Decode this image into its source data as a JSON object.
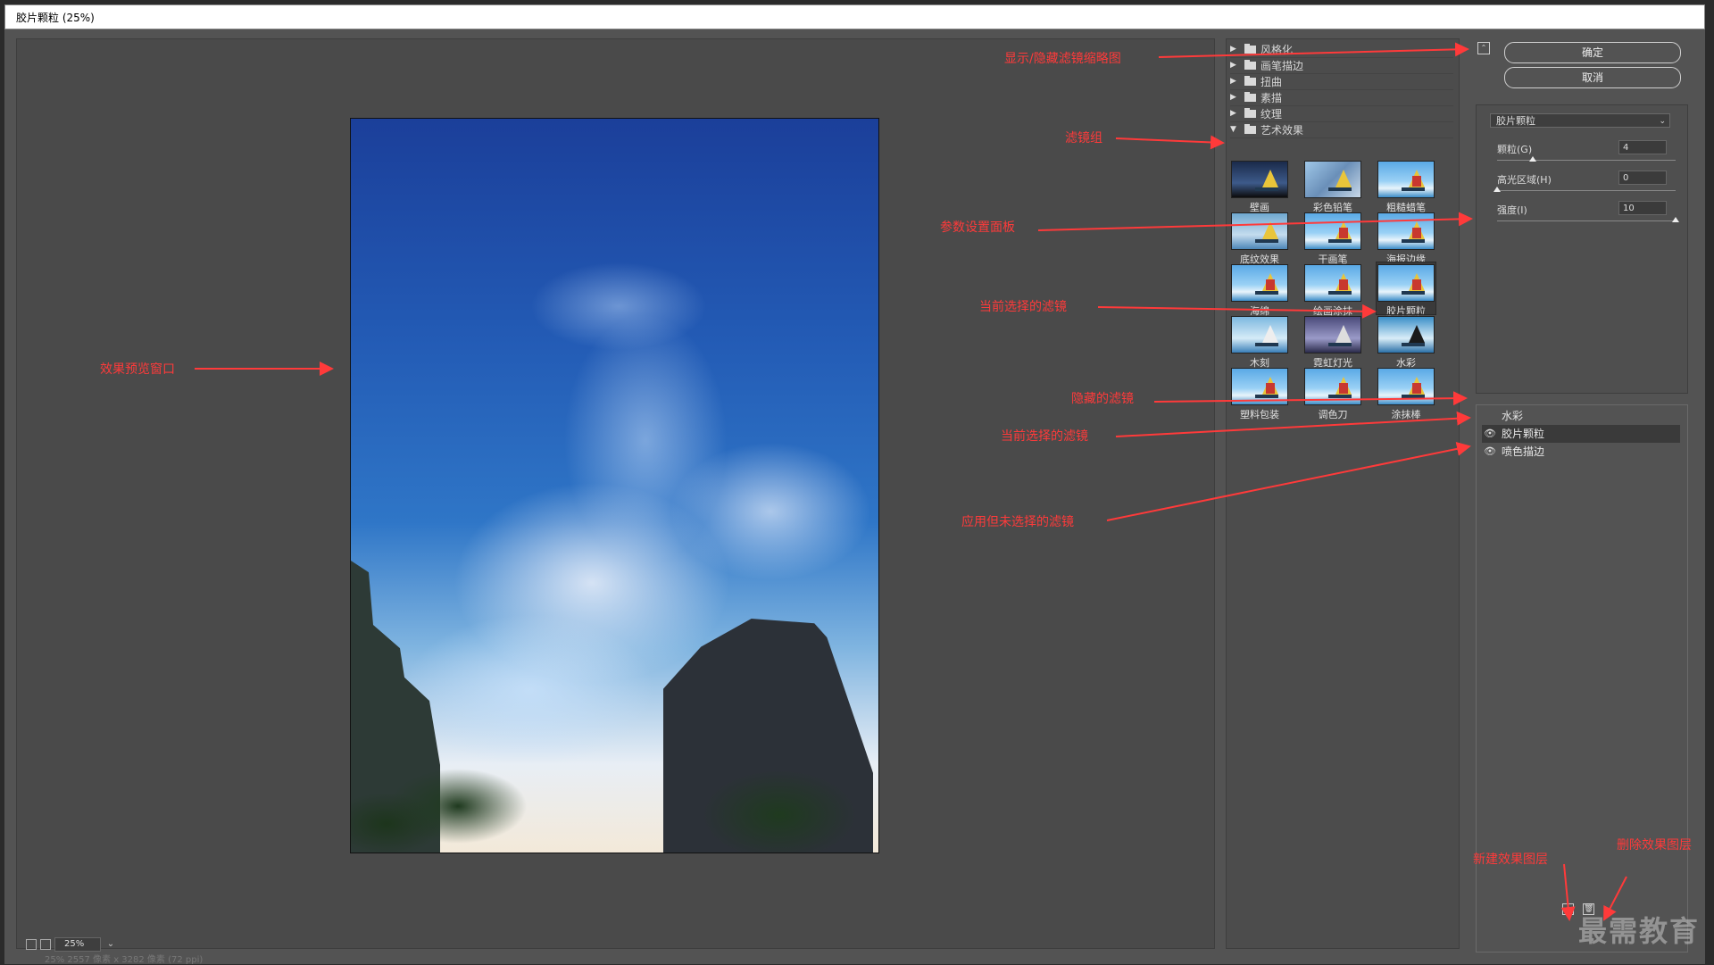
{
  "window": {
    "title": "胶片颗粒 (25%)"
  },
  "preview": {
    "zoom": "25%",
    "status": "25% 2557 像素 x 3282 像素 (72 ppi)"
  },
  "filter_groups": [
    {
      "label": "风格化",
      "expanded": false
    },
    {
      "label": "画笔描边",
      "expanded": false
    },
    {
      "label": "扭曲",
      "expanded": false
    },
    {
      "label": "素描",
      "expanded": false
    },
    {
      "label": "纹理",
      "expanded": false
    },
    {
      "label": "艺术效果",
      "expanded": true
    }
  ],
  "filters": [
    {
      "label": "壁画"
    },
    {
      "label": "彩色铅笔"
    },
    {
      "label": "粗糙蜡笔"
    },
    {
      "label": "底纹效果"
    },
    {
      "label": "干画笔"
    },
    {
      "label": "海报边缘"
    },
    {
      "label": "海绵"
    },
    {
      "label": "绘画涂抹"
    },
    {
      "label": "胶片颗粒",
      "selected": true
    },
    {
      "label": "木刻"
    },
    {
      "label": "霓虹灯光"
    },
    {
      "label": "水彩"
    },
    {
      "label": "塑料包装"
    },
    {
      "label": "调色刀"
    },
    {
      "label": "涂抹棒"
    }
  ],
  "buttons": {
    "ok": "确定",
    "cancel": "取消"
  },
  "params": {
    "filter": "胶片颗粒",
    "items": [
      {
        "name": "颗粒(G)",
        "value": "4",
        "fraction": 0.2
      },
      {
        "name": "高光区域(H)",
        "value": "0",
        "fraction": 0.0
      },
      {
        "name": "强度(I)",
        "value": "10",
        "fraction": 1.0
      }
    ]
  },
  "layers": [
    {
      "label": "水彩",
      "visible": false,
      "selected": false
    },
    {
      "label": "胶片颗粒",
      "visible": true,
      "selected": true
    },
    {
      "label": "喷色描边",
      "visible": true,
      "selected": false
    }
  ],
  "annotations": {
    "toggle_thumbs": "显示/隐藏滤镜缩略图",
    "filter_group": "滤镜组",
    "param_panel": "参数设置面板",
    "current_filter_1": "当前选择的滤镜",
    "hidden_filter": "隐藏的滤镜",
    "current_filter_2": "当前选择的滤镜",
    "applied_unselected": "应用但未选择的滤镜",
    "preview_window": "效果预览窗口",
    "new_layer": "新建效果图层",
    "delete_layer": "删除效果图层"
  },
  "watermark": "最需教育",
  "colors": {
    "annotation": "#ff3a3a",
    "dialog_bg": "#535353"
  }
}
